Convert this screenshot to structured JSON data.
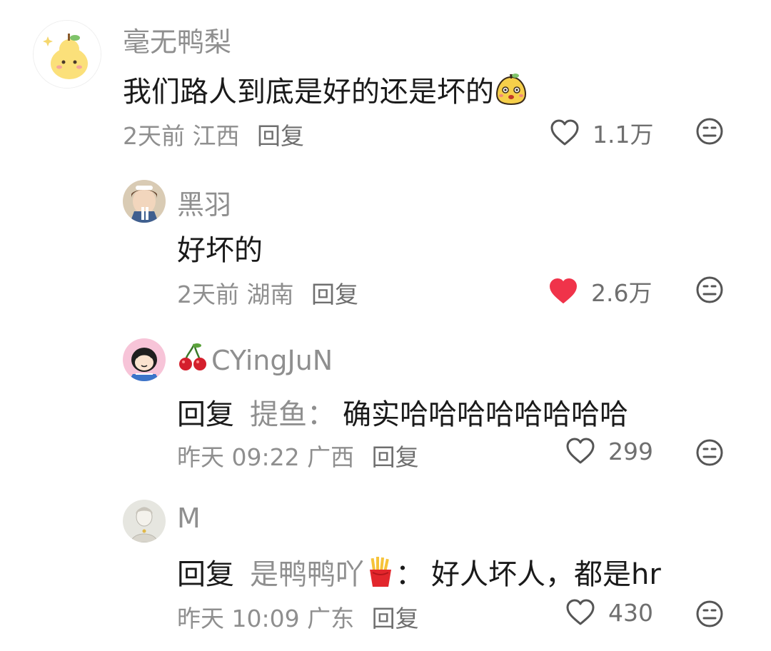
{
  "comments": [
    {
      "username": "毫无鸭梨",
      "content": "我们路人到底是好的还是坏的",
      "time": "2天前",
      "location": "江西",
      "reply_label": "回复",
      "likes": "1.1万",
      "liked": false,
      "avatar": "pear-avatar"
    },
    {
      "username": "黑羽",
      "content": "好坏的",
      "time": "2天前",
      "location": "湖南",
      "reply_label": "回复",
      "likes": "2.6万",
      "liked": true,
      "avatar": "boy-avatar"
    },
    {
      "username": "CYingJuN",
      "reply_prefix": "回复",
      "reply_target": "提鱼：",
      "content": "确实哈哈哈哈哈哈哈哈",
      "time": "昨天 09:22",
      "location": "广西",
      "reply_label": "回复",
      "likes": "299",
      "liked": false,
      "avatar": "girl-avatar"
    },
    {
      "username": "M",
      "reply_prefix": "回复",
      "reply_target": "是鸭鸭吖",
      "reply_target_colon": "：",
      "content": "好人坏人，都是hr",
      "time": "昨天 10:09",
      "location": "广东",
      "reply_label": "回复",
      "likes": "430",
      "liked": false,
      "avatar": "sketch-avatar"
    }
  ],
  "colors": {
    "liked_heart": "#f0334a",
    "muted_text": "#8f8f8f",
    "body_text": "#1a1a1a"
  }
}
